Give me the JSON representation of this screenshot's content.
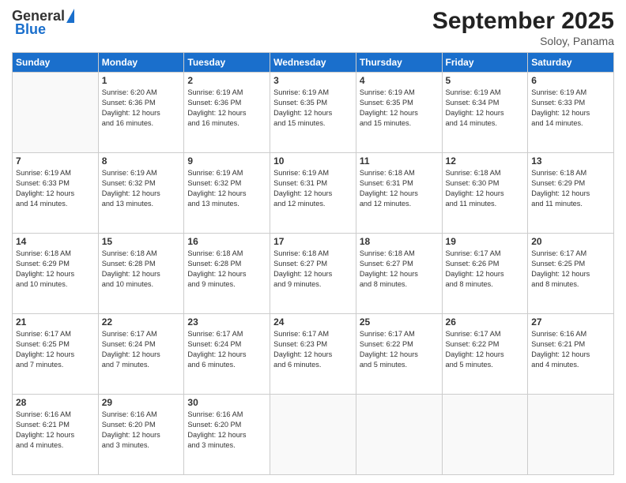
{
  "logo": {
    "general": "General",
    "blue": "Blue"
  },
  "header": {
    "month": "September 2025",
    "location": "Soloy, Panama"
  },
  "weekdays": [
    "Sunday",
    "Monday",
    "Tuesday",
    "Wednesday",
    "Thursday",
    "Friday",
    "Saturday"
  ],
  "weeks": [
    [
      {
        "day": "",
        "info": ""
      },
      {
        "day": "1",
        "info": "Sunrise: 6:20 AM\nSunset: 6:36 PM\nDaylight: 12 hours\nand 16 minutes."
      },
      {
        "day": "2",
        "info": "Sunrise: 6:19 AM\nSunset: 6:36 PM\nDaylight: 12 hours\nand 16 minutes."
      },
      {
        "day": "3",
        "info": "Sunrise: 6:19 AM\nSunset: 6:35 PM\nDaylight: 12 hours\nand 15 minutes."
      },
      {
        "day": "4",
        "info": "Sunrise: 6:19 AM\nSunset: 6:35 PM\nDaylight: 12 hours\nand 15 minutes."
      },
      {
        "day": "5",
        "info": "Sunrise: 6:19 AM\nSunset: 6:34 PM\nDaylight: 12 hours\nand 14 minutes."
      },
      {
        "day": "6",
        "info": "Sunrise: 6:19 AM\nSunset: 6:33 PM\nDaylight: 12 hours\nand 14 minutes."
      }
    ],
    [
      {
        "day": "7",
        "info": ""
      },
      {
        "day": "8",
        "info": "Sunrise: 6:19 AM\nSunset: 6:32 PM\nDaylight: 12 hours\nand 13 minutes."
      },
      {
        "day": "9",
        "info": "Sunrise: 6:19 AM\nSunset: 6:32 PM\nDaylight: 12 hours\nand 13 minutes."
      },
      {
        "day": "10",
        "info": "Sunrise: 6:19 AM\nSunset: 6:31 PM\nDaylight: 12 hours\nand 12 minutes."
      },
      {
        "day": "11",
        "info": "Sunrise: 6:18 AM\nSunset: 6:31 PM\nDaylight: 12 hours\nand 12 minutes."
      },
      {
        "day": "12",
        "info": "Sunrise: 6:18 AM\nSunset: 6:30 PM\nDaylight: 12 hours\nand 11 minutes."
      },
      {
        "day": "13",
        "info": "Sunrise: 6:18 AM\nSunset: 6:29 PM\nDaylight: 12 hours\nand 11 minutes."
      }
    ],
    [
      {
        "day": "14",
        "info": ""
      },
      {
        "day": "15",
        "info": "Sunrise: 6:18 AM\nSunset: 6:28 PM\nDaylight: 12 hours\nand 10 minutes."
      },
      {
        "day": "16",
        "info": "Sunrise: 6:18 AM\nSunset: 6:28 PM\nDaylight: 12 hours\nand 9 minutes."
      },
      {
        "day": "17",
        "info": "Sunrise: 6:18 AM\nSunset: 6:27 PM\nDaylight: 12 hours\nand 9 minutes."
      },
      {
        "day": "18",
        "info": "Sunrise: 6:18 AM\nSunset: 6:27 PM\nDaylight: 12 hours\nand 8 minutes."
      },
      {
        "day": "19",
        "info": "Sunrise: 6:17 AM\nSunset: 6:26 PM\nDaylight: 12 hours\nand 8 minutes."
      },
      {
        "day": "20",
        "info": "Sunrise: 6:17 AM\nSunset: 6:25 PM\nDaylight: 12 hours\nand 8 minutes."
      }
    ],
    [
      {
        "day": "21",
        "info": ""
      },
      {
        "day": "22",
        "info": "Sunrise: 6:17 AM\nSunset: 6:24 PM\nDaylight: 12 hours\nand 7 minutes."
      },
      {
        "day": "23",
        "info": "Sunrise: 6:17 AM\nSunset: 6:24 PM\nDaylight: 12 hours\nand 6 minutes."
      },
      {
        "day": "24",
        "info": "Sunrise: 6:17 AM\nSunset: 6:23 PM\nDaylight: 12 hours\nand 6 minutes."
      },
      {
        "day": "25",
        "info": "Sunrise: 6:17 AM\nSunset: 6:22 PM\nDaylight: 12 hours\nand 5 minutes."
      },
      {
        "day": "26",
        "info": "Sunrise: 6:17 AM\nSunset: 6:22 PM\nDaylight: 12 hours\nand 5 minutes."
      },
      {
        "day": "27",
        "info": "Sunrise: 6:16 AM\nSunset: 6:21 PM\nDaylight: 12 hours\nand 4 minutes."
      }
    ],
    [
      {
        "day": "28",
        "info": "Sunrise: 6:16 AM\nSunset: 6:21 PM\nDaylight: 12 hours\nand 4 minutes."
      },
      {
        "day": "29",
        "info": "Sunrise: 6:16 AM\nSunset: 6:20 PM\nDaylight: 12 hours\nand 3 minutes."
      },
      {
        "day": "30",
        "info": "Sunrise: 6:16 AM\nSunset: 6:20 PM\nDaylight: 12 hours\nand 3 minutes."
      },
      {
        "day": "",
        "info": ""
      },
      {
        "day": "",
        "info": ""
      },
      {
        "day": "",
        "info": ""
      },
      {
        "day": "",
        "info": ""
      }
    ]
  ],
  "week7_sunday_info": "Sunrise: 6:19 AM\nSunset: 6:33 PM\nDaylight: 12 hours\nand 14 minutes.",
  "week14_sunday_info": "Sunrise: 6:18 AM\nSunset: 6:29 PM\nDaylight: 12 hours\nand 10 minutes.",
  "week21_sunday_info": "Sunrise: 6:17 AM\nSunset: 6:25 PM\nDaylight: 12 hours\nand 7 minutes."
}
